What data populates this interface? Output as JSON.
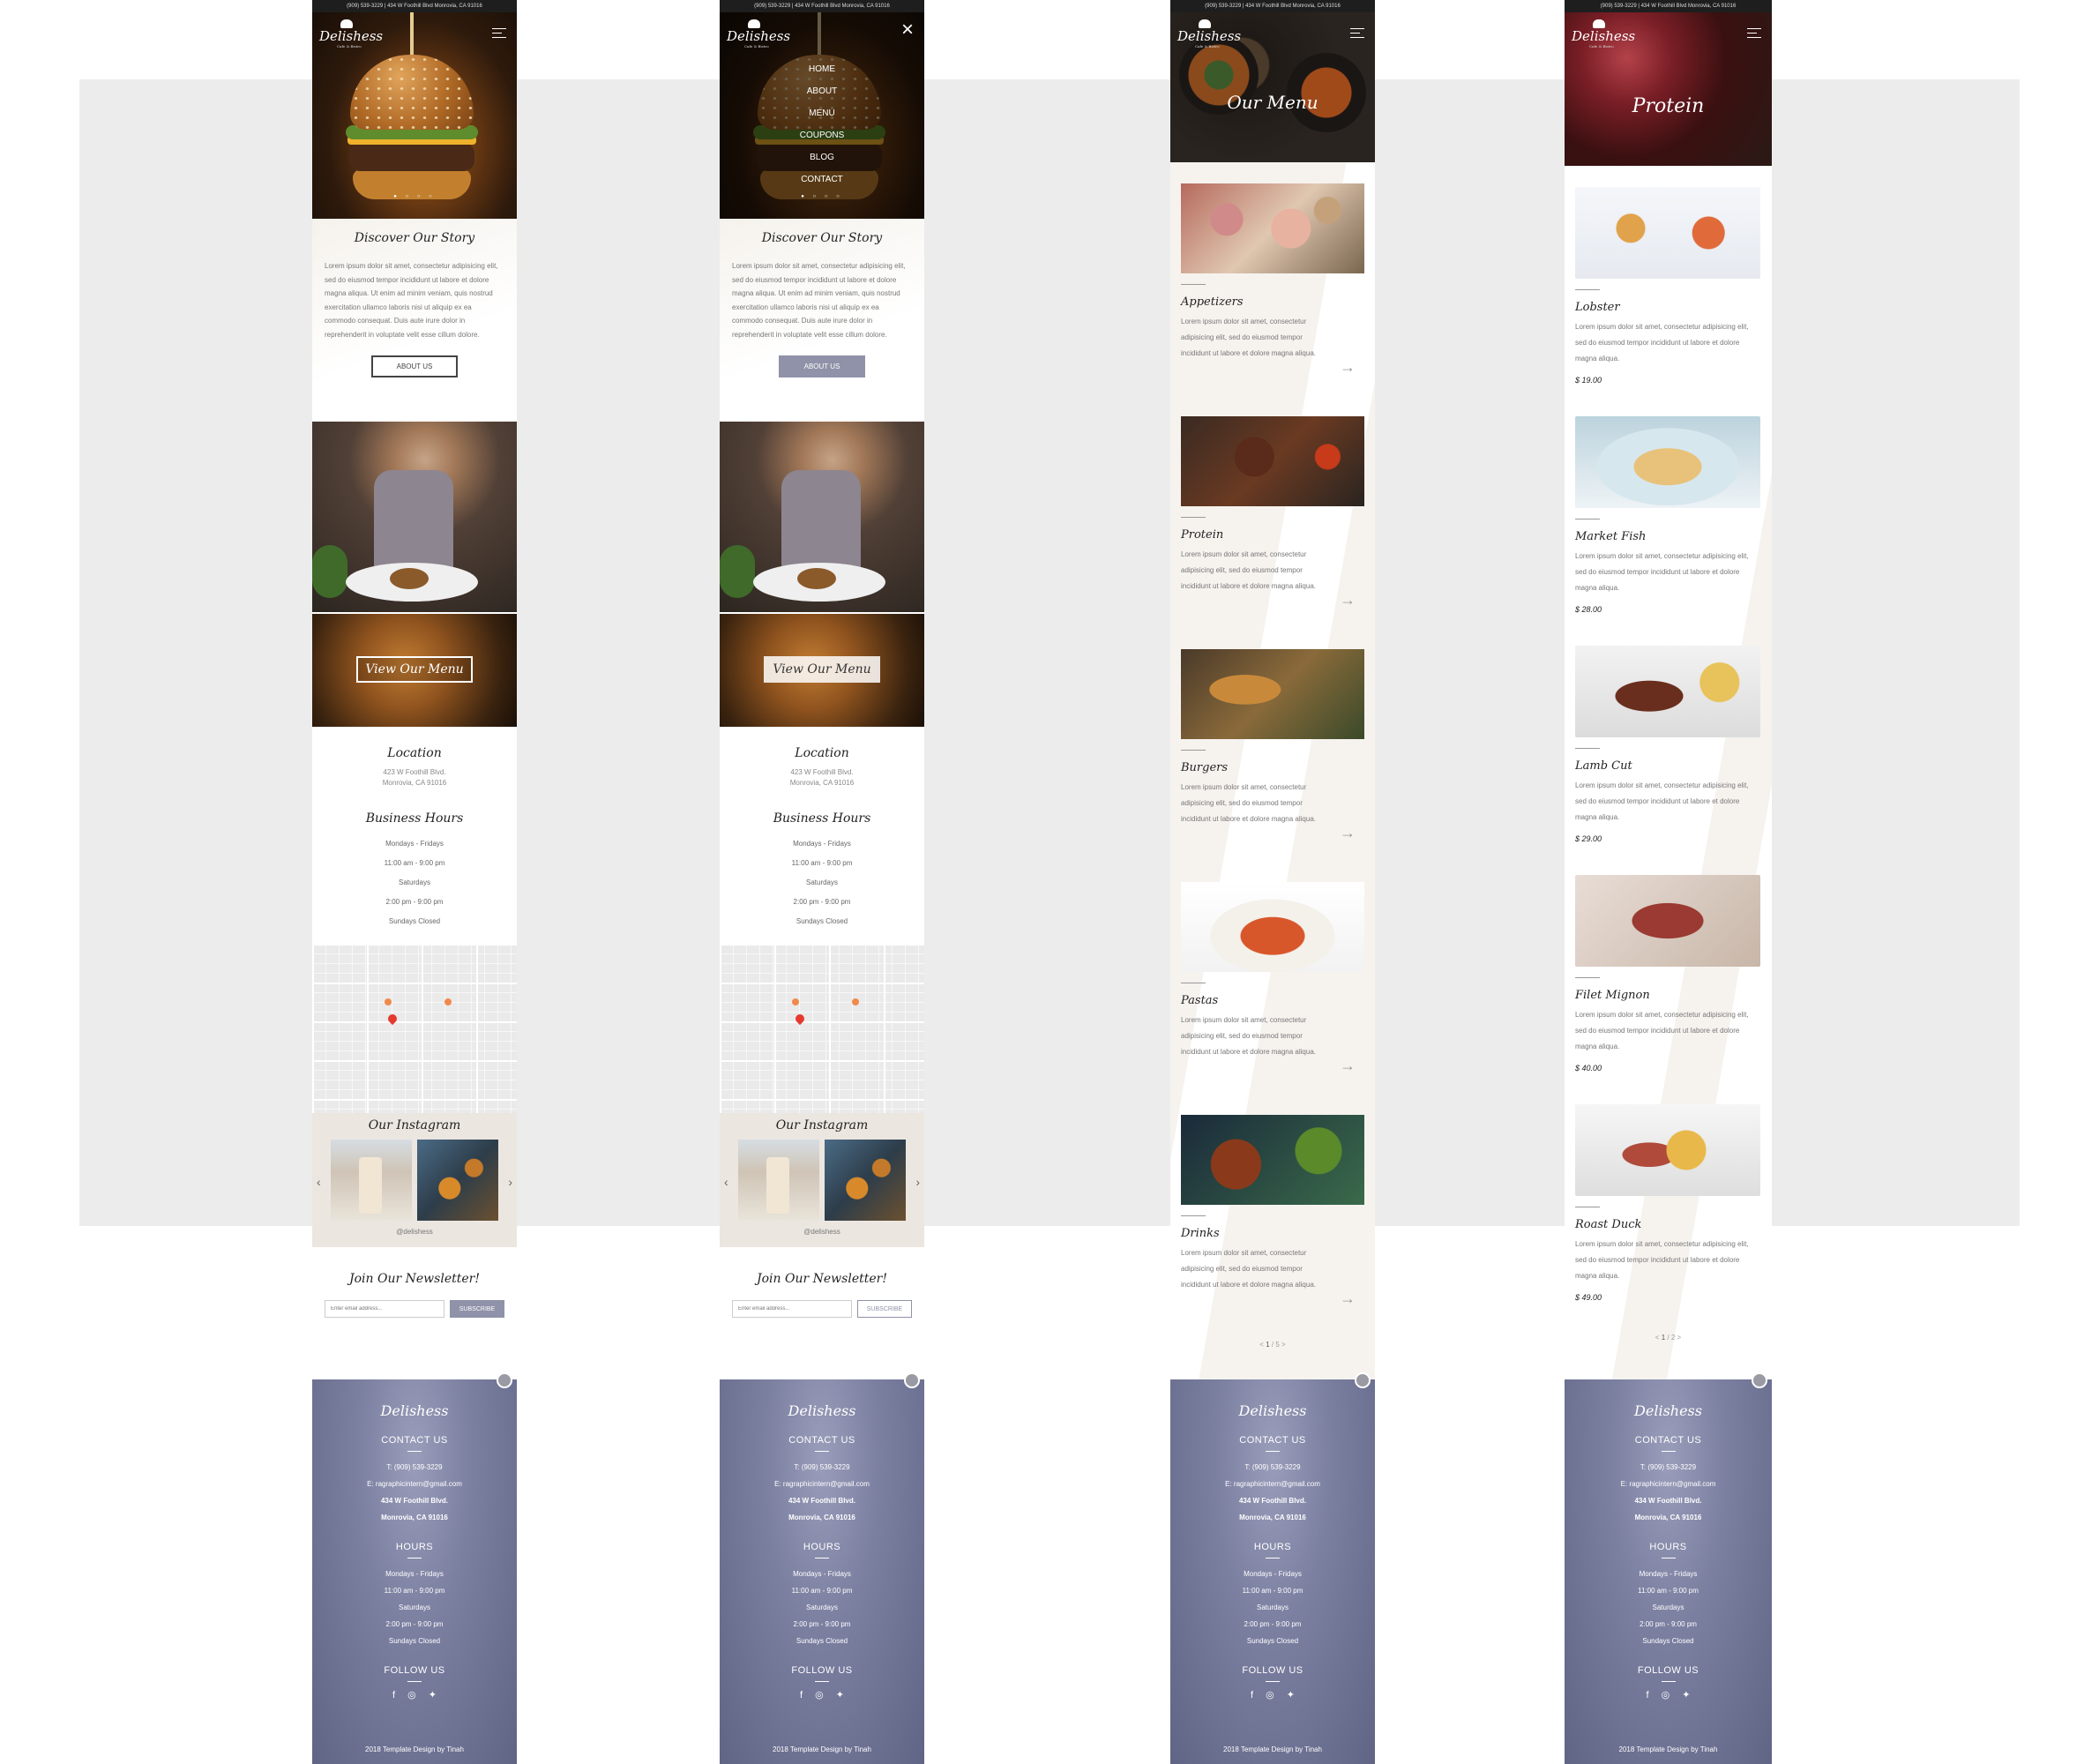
{
  "topbar": "(909) 539-3229 | 434 W Foothill Blvd Monrovia, CA 91016",
  "brand": {
    "name": "Delishess",
    "tagline": "Cafe & Bistro"
  },
  "nav": [
    "HOME",
    "ABOUT",
    "MENU",
    "COUPONS",
    "BLOG",
    "CONTACT"
  ],
  "hero_dots": "● ○ ○ ○",
  "story": {
    "title": "Discover Our Story",
    "body": "Lorem ipsum dolor sit amet, consectetur adipisicing elit, sed do eiusmod tempor incididunt ut labore et dolore magna aliqua. Ut enim ad minim veniam, quis nostrud exercitation ullamco laboris nisi ut aliquip ex ea commodo consequat. Duis aute irure dolor in reprehenderit in voluptate velit esse cillum dolore.",
    "button": "ABOUT US"
  },
  "view_menu": "View Our Menu",
  "location": {
    "title": "Location",
    "line1": "423 W Foothill Blvd.",
    "line2": "Monrovia, CA 91016"
  },
  "hours": {
    "title": "Business Hours",
    "lines": [
      "Mondays - Fridays",
      "11:00 am - 9:00 pm",
      "Saturdays",
      "2:00 pm - 9:00 pm",
      "Sundays Closed"
    ]
  },
  "instagram": {
    "title": "Our Instagram",
    "handle": "@delishess",
    "prev": "‹",
    "next": "›"
  },
  "newsletter": {
    "title": "Join Our Newsletter!",
    "placeholder": "Enter email address...",
    "button": "SUBSCRIBE"
  },
  "footer": {
    "contact_title": "CONTACT US",
    "phone": "T: (909) 539-3229",
    "email": "E: ragraphicintern@gmail.com",
    "addr1": "434 W Foothill Blvd.",
    "addr2": "Monrovia, CA 91016",
    "hours_title": "HOURS",
    "hours": [
      "Mondays - Fridays",
      "11:00 am - 9:00 pm",
      "Saturdays",
      "2:00 pm - 9:00 pm",
      "Sundays Closed"
    ],
    "follow_title": "FOLLOW US",
    "icons": [
      "facebook-icon",
      "instagram-icon",
      "twitter-icon"
    ],
    "copyright": "2018 Template Design by Tinah"
  },
  "menu_page": {
    "title": "Our Menu",
    "items": [
      {
        "name": "Appetizers",
        "desc": "Lorem ipsum dolor sit amet, consectetur adipisicing elit, sed do eiusmod tempor incididunt ut labore et dolore magna aliqua."
      },
      {
        "name": "Protein",
        "desc": "Lorem ipsum dolor sit amet, consectetur adipisicing elit, sed do eiusmod tempor incididunt ut labore et dolore magna aliqua."
      },
      {
        "name": "Burgers",
        "desc": "Lorem ipsum dolor sit amet, consectetur adipisicing elit, sed do eiusmod tempor incididunt ut labore et dolore magna aliqua."
      },
      {
        "name": "Pastas",
        "desc": "Lorem ipsum dolor sit amet, consectetur adipisicing elit, sed do eiusmod tempor incididunt ut labore et dolore magna aliqua."
      },
      {
        "name": "Drinks",
        "desc": "Lorem ipsum dolor sit amet, consectetur adipisicing elit, sed do eiusmod tempor incididunt ut labore et dolore magna aliqua."
      }
    ],
    "pager": {
      "prev": "<",
      "current": "1",
      "sep": "/",
      "total": "5",
      "next": ">"
    }
  },
  "protein_page": {
    "title": "Protein",
    "items": [
      {
        "name": "Lobster",
        "desc": "Lorem ipsum dolor sit amet, consectetur adipisicing elit, sed do eiusmod tempor incididunt ut labore et dolore magna aliqua.",
        "price": "$ 19.00"
      },
      {
        "name": "Market Fish",
        "desc": "Lorem ipsum dolor sit amet, consectetur adipisicing elit, sed do eiusmod tempor incididunt ut labore et dolore magna aliqua.",
        "price": "$ 28.00"
      },
      {
        "name": "Lamb Cut",
        "desc": "Lorem ipsum dolor sit amet, consectetur adipisicing elit, sed do eiusmod tempor incididunt ut labore et dolore magna aliqua.",
        "price": "$ 29.00"
      },
      {
        "name": "Filet Mignon",
        "desc": "Lorem ipsum dolor sit amet, consectetur adipisicing elit, sed do eiusmod tempor incididunt ut labore et dolore magna aliqua.",
        "price": "$ 40.00"
      },
      {
        "name": "Roast Duck",
        "desc": "Lorem ipsum dolor sit amet, consectetur adipisicing elit, sed do eiusmod tempor incididunt ut labore et dolore magna aliqua.",
        "price": "$ 49.00"
      }
    ],
    "pager": {
      "prev": "<",
      "current": "1",
      "sep": "/",
      "total": "2",
      "next": ">"
    }
  },
  "colors": {
    "accent": "#8f92a8",
    "footer": "#7b7fa0",
    "cream": "#f6f3ef"
  }
}
